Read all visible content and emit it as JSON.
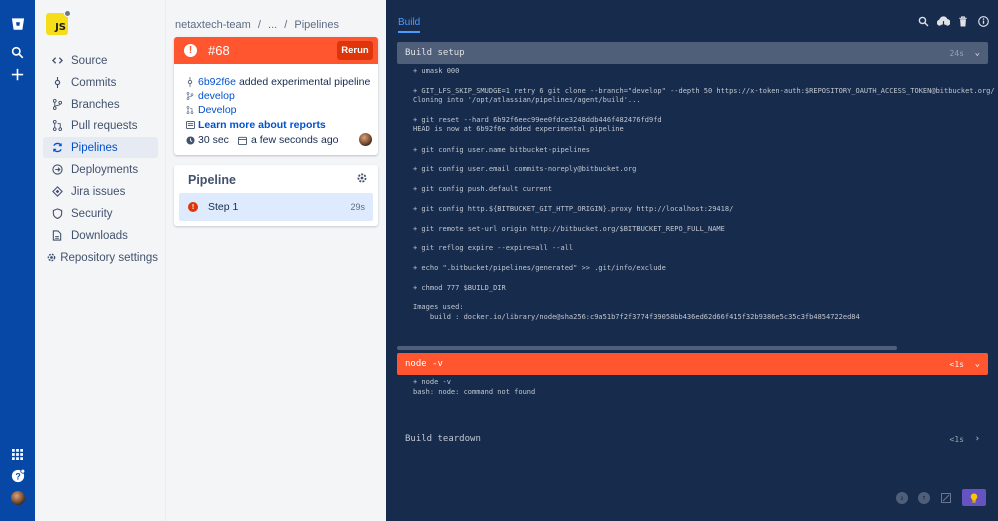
{
  "sidebar": {
    "repo_avatar_text": "JS",
    "items": [
      {
        "label": "Source"
      },
      {
        "label": "Commits"
      },
      {
        "label": "Branches"
      },
      {
        "label": "Pull requests"
      },
      {
        "label": "Pipelines"
      },
      {
        "label": "Deployments"
      },
      {
        "label": "Jira issues"
      },
      {
        "label": "Security"
      },
      {
        "label": "Downloads"
      },
      {
        "label": "Repository settings"
      }
    ]
  },
  "breadcrumb": [
    "netaxtech-team",
    "/",
    "...",
    "/",
    "Pipelines"
  ],
  "run": {
    "number": "#68",
    "rerun_label": "Rerun",
    "commit_hash": "6b92f6e",
    "commit_message": "added experimental pipeline",
    "branch": "develop",
    "target": "Develop",
    "learn_more": "Learn more about reports",
    "duration": "30 sec",
    "time_ago": "a few seconds ago",
    "status_color": "#ff5630"
  },
  "pipeline": {
    "title": "Pipeline",
    "step_name": "Step 1",
    "step_duration": "29s"
  },
  "log": {
    "tab_label": "Build",
    "setup": {
      "title": "Build setup",
      "duration": "24s"
    },
    "setup_lines": [
      "+ umask 000",
      "+ GIT_LFS_SKIP_SMUDGE=1 retry 6 git clone --branch=\"develop\" --depth 50 https://x-token-auth:$REPOSITORY_OAUTH_ACCESS_TOKEN@bitbucket.org/$BITBUCKET_",
      "Cloning into '/opt/atlassian/pipelines/agent/build'...",
      "+ git reset --hard 6b92f6eec99ee0fdce3248ddb446f482476fd9fd",
      "HEAD is now at 6b92f6e added experimental pipeline",
      "+ git config user.name bitbucket-pipelines",
      "+ git config user.email commits-noreply@bitbucket.org",
      "+ git config push.default current",
      "+ git config http.${BITBUCKET_GIT_HTTP_ORIGIN}.proxy http://localhost:29418/",
      "+ git remote set-url origin http://bitbucket.org/$BITBUCKET_REPO_FULL_NAME",
      "+ git reflog expire --expire=all --all",
      "+ echo \".bitbucket/pipelines/generated\" >> .git/info/exclude",
      "+ chmod 777 $BUILD_DIR",
      "Images used:",
      "    build : docker.io/library/node@sha256:c9a51b7f2f3774f39058bb436ed62d66f415f32b9386e5c35c3fb4854722ed84"
    ],
    "node": {
      "title": "node -v",
      "duration": "<1s"
    },
    "node_lines": [
      "+ node -v",
      "bash: node: command not found"
    ],
    "teardown": {
      "title": "Build teardown",
      "duration": "<1s"
    }
  },
  "colors": {
    "global_nav": "#0747a6",
    "log_bg": "#172b4d",
    "error": "#ff5630",
    "accent": "#0052cc"
  }
}
